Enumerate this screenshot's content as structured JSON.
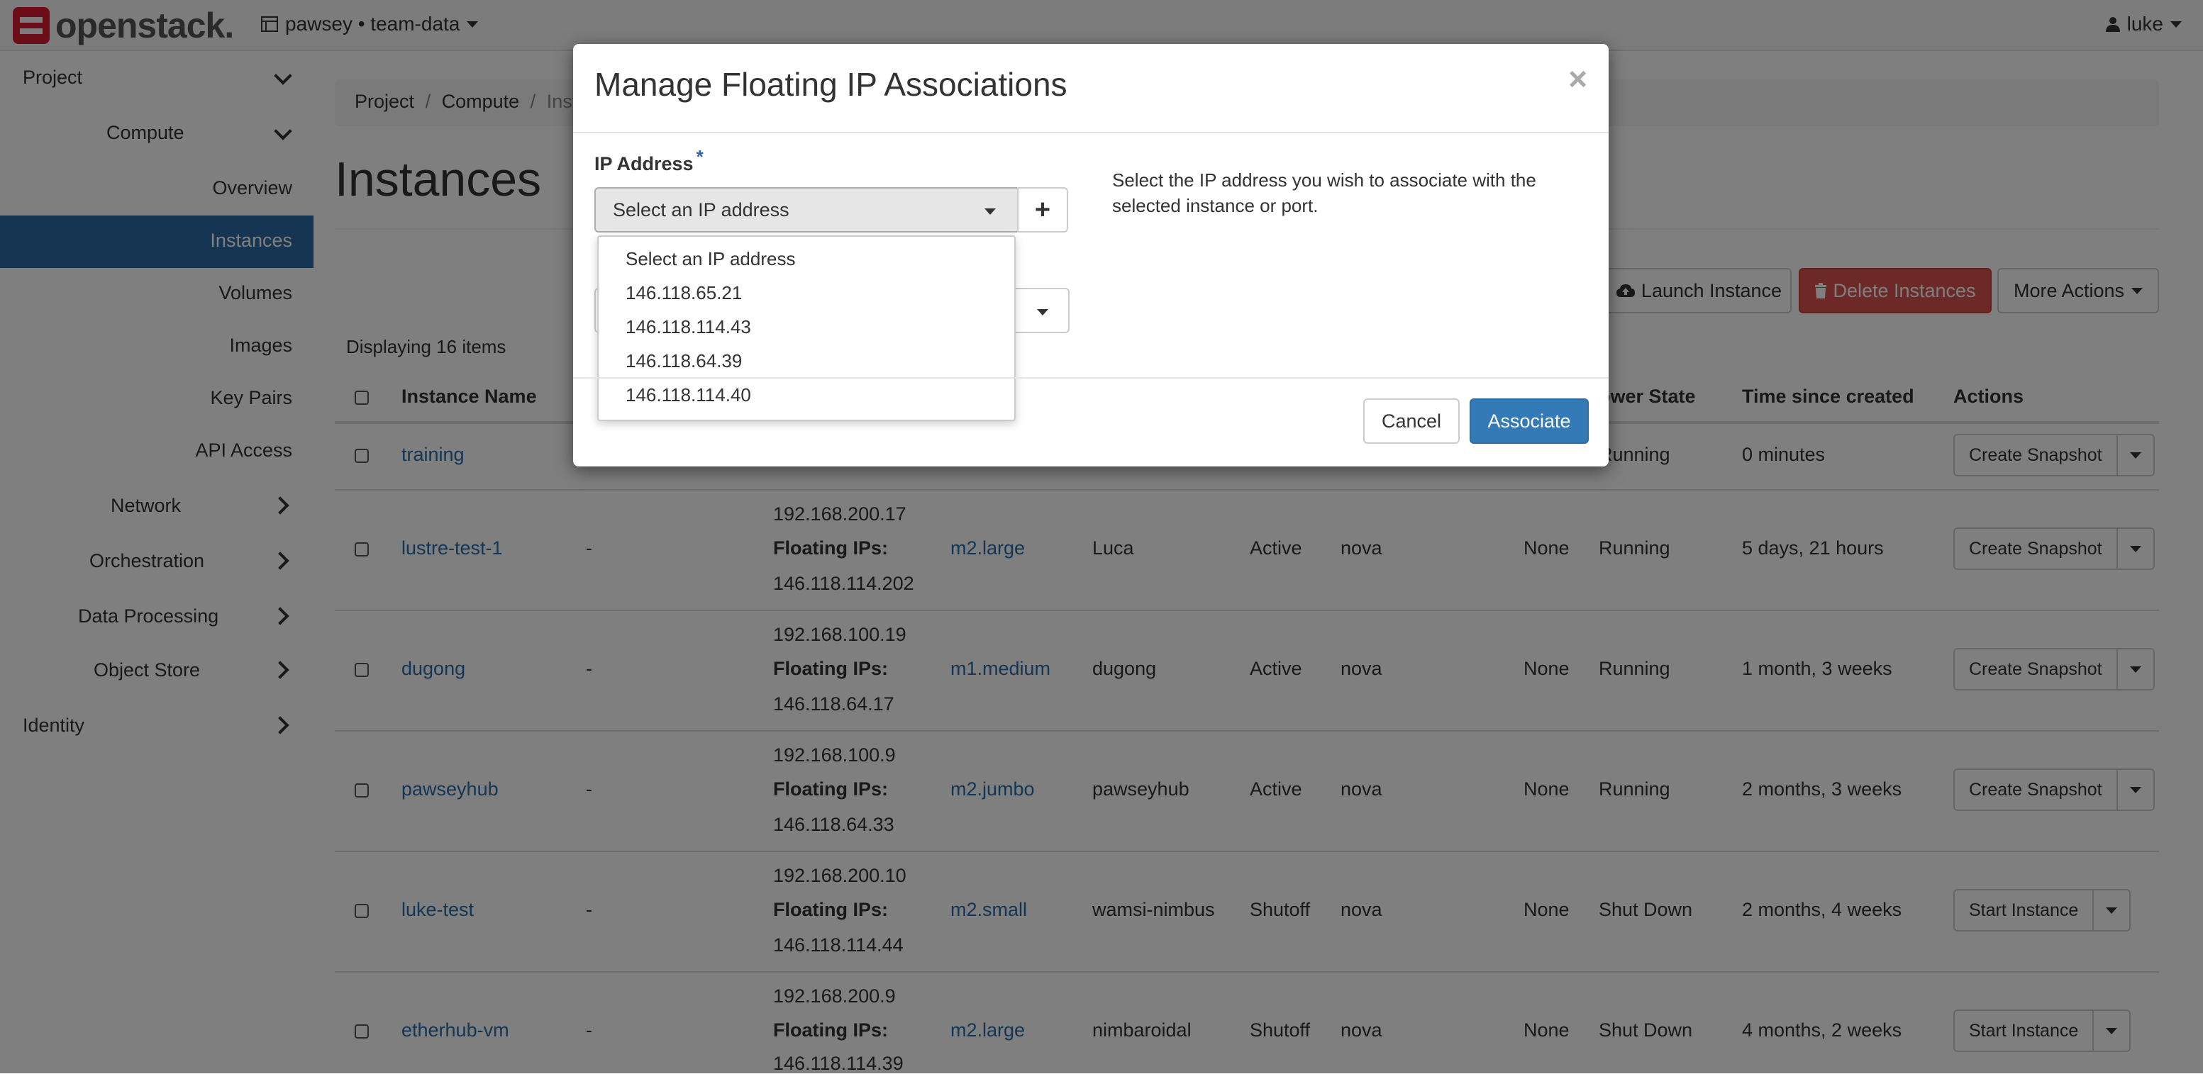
{
  "navbar": {
    "logo_text": "openstack.",
    "project": "pawsey • team-data",
    "user": "luke"
  },
  "sidebar": {
    "project": "Project",
    "compute": "Compute",
    "overview": "Overview",
    "instances": "Instances",
    "volumes": "Volumes",
    "images": "Images",
    "key_pairs": "Key Pairs",
    "api_access": "API Access",
    "network": "Network",
    "orchestration": "Orchestration",
    "data_processing": "Data Processing",
    "object_store": "Object Store",
    "identity": "Identity"
  },
  "breadcrumb": {
    "items": [
      "Project",
      "Compute",
      "Inst"
    ],
    "separator": "/"
  },
  "page": {
    "title": "Instances",
    "count": "Displaying 16 items"
  },
  "actions": {
    "launch": "Launch Instance",
    "delete": "Delete Instances",
    "more": "More Actions"
  },
  "table": {
    "headers": {
      "name": "Instance Name",
      "power": "ower State",
      "time": "Time since created",
      "actions": "Actions"
    },
    "rows": [
      {
        "name": "training",
        "power": "Running",
        "time": "0 minutes",
        "action": "Create Snapshot"
      },
      {
        "name": "lustre-test-1",
        "image": "-",
        "ip": "192.168.200.17",
        "fip_label": "Floating IPs:",
        "fip": "146.118.114.202",
        "flavor": "m2.large",
        "key": "Luca",
        "status": "Active",
        "zone": "nova",
        "task": "None",
        "power": "Running",
        "time": "5 days, 21 hours",
        "action": "Create Snapshot"
      },
      {
        "name": "dugong",
        "image": "-",
        "ip": "192.168.100.19",
        "fip_label": "Floating IPs:",
        "fip": "146.118.64.17",
        "flavor": "m1.medium",
        "key": "dugong",
        "status": "Active",
        "zone": "nova",
        "task": "None",
        "power": "Running",
        "time": "1 month, 3 weeks",
        "action": "Create Snapshot"
      },
      {
        "name": "pawseyhub",
        "image": "-",
        "ip": "192.168.100.9",
        "fip_label": "Floating IPs:",
        "fip": "146.118.64.33",
        "flavor": "m2.jumbo",
        "key": "pawseyhub",
        "status": "Active",
        "zone": "nova",
        "task": "None",
        "power": "Running",
        "time": "2 months, 3 weeks",
        "action": "Create Snapshot"
      },
      {
        "name": "luke-test",
        "image": "-",
        "ip": "192.168.200.10",
        "fip_label": "Floating IPs:",
        "fip": "146.118.114.44",
        "flavor": "m2.small",
        "key": "wamsi-nimbus",
        "status": "Shutoff",
        "zone": "nova",
        "task": "None",
        "power": "Shut Down",
        "time": "2 months, 4 weeks",
        "action": "Start Instance"
      },
      {
        "name": "etherhub-vm",
        "image": "-",
        "ip": "192.168.200.9",
        "fip_label": "Floating IPs:",
        "fip": "146.118.114.39",
        "flavor": "m2.large",
        "key": "nimbaroidal",
        "status": "Shutoff",
        "zone": "nova",
        "task": "None",
        "power": "Shut Down",
        "time": "4 months, 2 weeks",
        "action": "Start Instance"
      }
    ]
  },
  "modal": {
    "title": "Manage Floating IP Associations",
    "close": "×",
    "ip_label": "IP Address",
    "required_mark": "*",
    "select_value": "Select an IP address",
    "help": "Select the IP address you wish to associate with the selected instance or port.",
    "plus": "+",
    "options": [
      "Select an IP address",
      "146.118.65.21",
      "146.118.114.43",
      "146.118.64.39",
      "146.118.114.40"
    ],
    "cancel": "Cancel",
    "associate": "Associate"
  }
}
